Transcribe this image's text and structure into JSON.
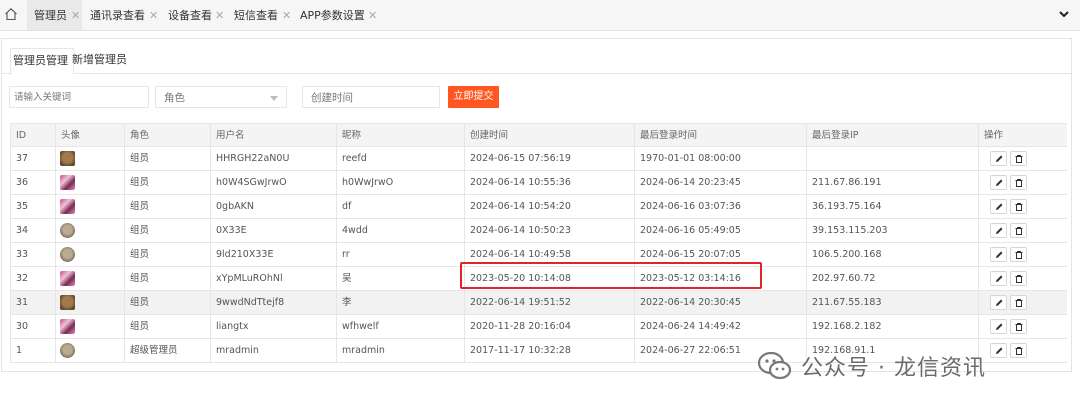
{
  "tabs": [
    {
      "label": "管理员",
      "active": true
    },
    {
      "label": "通讯录查看",
      "active": false
    },
    {
      "label": "设备查看",
      "active": false
    },
    {
      "label": "短信查看",
      "active": false
    },
    {
      "label": "APP参数设置",
      "active": false
    }
  ],
  "subtabs": {
    "manage": "管理员管理",
    "add": "新增管理员"
  },
  "filters": {
    "keyword_placeholder": "请输入关键词",
    "role_placeholder": "角色",
    "time_placeholder": "创建时间",
    "submit_label": "立即提交"
  },
  "table": {
    "headers": [
      "ID",
      "头像",
      "角色",
      "用户名",
      "昵称",
      "创建时间",
      "最后登录时间",
      "最后登录IP",
      "操作"
    ],
    "rows": [
      {
        "id": "37",
        "avatar": "brown",
        "role": "组员",
        "username": "HHRGH22aN0U",
        "nickname": "reefd",
        "created": "2024-06-15 07:56:19",
        "last_login": "1970-01-01 08:00:00",
        "ip": ""
      },
      {
        "id": "36",
        "avatar": "pink",
        "role": "组员",
        "username": "h0W4SGwJrwO",
        "nickname": "h0WwJrwO",
        "created": "2024-06-14 10:55:36",
        "last_login": "2024-06-14 20:23:45",
        "ip": "211.67.86.191"
      },
      {
        "id": "35",
        "avatar": "pink",
        "role": "组员",
        "username": "0gbAKN",
        "nickname": "df",
        "created": "2024-06-14 10:54:20",
        "last_login": "2024-06-16 03:07:36",
        "ip": "36.193.75.164"
      },
      {
        "id": "34",
        "avatar": "grey",
        "role": "组员",
        "username": "0X33E",
        "nickname": "4wdd",
        "created": "2024-06-14 10:50:23",
        "last_login": "2024-06-16 05:49:05",
        "ip": "39.153.115.203"
      },
      {
        "id": "33",
        "avatar": "grey",
        "role": "组员",
        "username": "9ld210X33E",
        "nickname": "rr",
        "created": "2024-06-14 10:49:58",
        "last_login": "2024-06-15 20:07:05",
        "ip": "106.5.200.168"
      },
      {
        "id": "32",
        "avatar": "pink",
        "role": "组员",
        "username": "xYpMLuROhNl",
        "nickname": "吴",
        "created": "2023-05-20 10:14:08",
        "last_login": "2023-05-12 03:14:16",
        "ip": "202.97.60.72"
      },
      {
        "id": "31",
        "avatar": "brown",
        "role": "组员",
        "username": "9wwdNdTtejf8",
        "nickname": "李",
        "created": "2022-06-14 19:51:52",
        "last_login": "2022-06-14 20:30:45",
        "ip": "211.67.55.183"
      },
      {
        "id": "30",
        "avatar": "pink",
        "role": "组员",
        "username": "liangtx",
        "nickname": "wfhwelf",
        "created": "2020-11-28 20:16:04",
        "last_login": "2024-06-24 14:49:42",
        "ip": "192.168.2.182"
      },
      {
        "id": "1",
        "avatar": "grey",
        "role": "超级管理员",
        "username": "mradmin",
        "nickname": "mradmin",
        "created": "2017-11-17 10:32:28",
        "last_login": "2024-06-27 22:06:51",
        "ip": "192.168.91.1"
      }
    ]
  },
  "watermark": "公众号 · 龙信资讯",
  "colors": {
    "accent": "#ff5722",
    "highlight": "#e0242a"
  }
}
